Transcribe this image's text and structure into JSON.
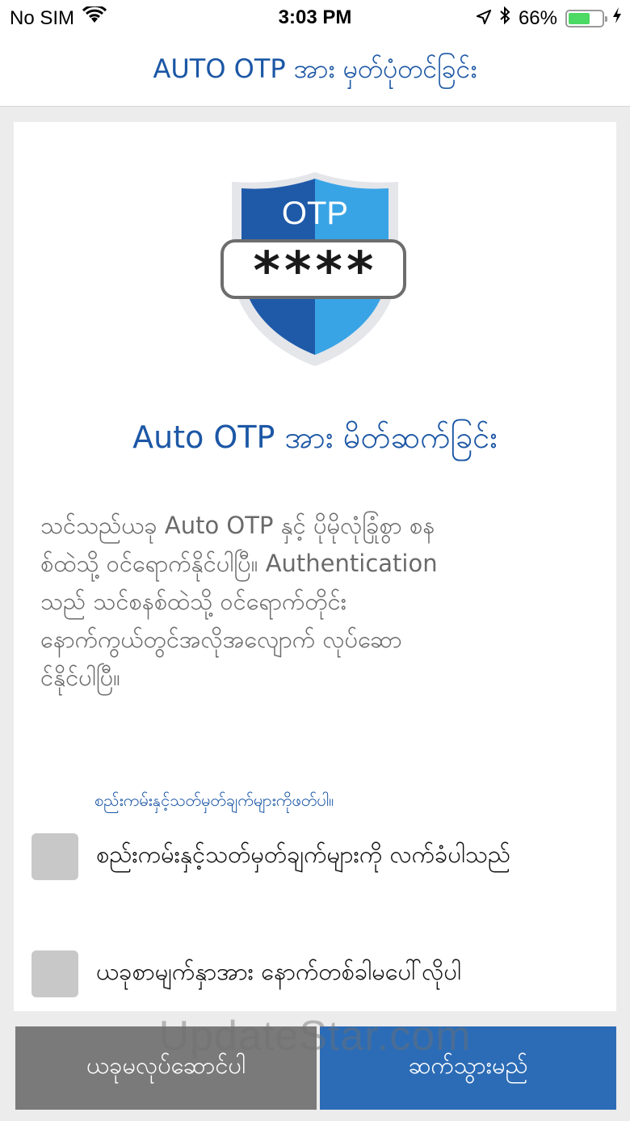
{
  "status_bar": {
    "carrier": "No SIM",
    "time": "3:03 PM",
    "battery": "66%",
    "battery_level": 0.66,
    "icons": [
      "wifi-icon",
      "location-arrow-icon",
      "bluetooth-icon",
      "battery-icon",
      "charging-bolt-icon"
    ]
  },
  "nav": {
    "title": "AUTO OTP အား မှတ်ပုံတင်ခြင်း"
  },
  "illustration": {
    "icon": "otp-shield-icon",
    "label": "OTP",
    "code_mask": "****",
    "colors": {
      "dark_blue": "#1f5aa9",
      "light_blue": "#38a4e6",
      "rim": "#e4e6ea"
    }
  },
  "card": {
    "title": "Auto OTP အား မိတ်ဆက်ခြင်း",
    "description": [
      "သင်သည်ယခု Auto OTP နှင့် ပိုမိုလုံခြုံစွာ စန",
      "စ်ထဲသို့ ဝင်ရောက်နိုင်ပါပြီ။ Authentication",
      "သည် သင်စနစ်ထဲသို့ ဝင်ရောက်တိုင်း",
      "နောက်ကွယ်တွင်အလိုအလျောက် လုပ်ဆော",
      "င်နိုင်ပါပြီ။"
    ],
    "terms_link": "စည်းကမ်းနှင့်သတ်မှတ်ချက်များကိုဖတ်ပါ။",
    "checkboxes": [
      {
        "label": "စည်းကမ်းနှင့်သတ်မှတ်ချက်များကို လက်ခံပါသည်"
      },
      {
        "label": "ယခုစာမျက်နှာအား နောက်တစ်ခါမပေါ်လိုပါ"
      }
    ]
  },
  "buttons": {
    "decline": "ယခုမလုပ်ဆောင်ပါ",
    "continue": "ဆက်သွားမည်"
  },
  "watermark": "UpdateStar.com",
  "colors": {
    "accent": "#1c57a5",
    "primary_button": "#2c6cb6",
    "secondary_button": "#7a7a7a",
    "checkbox": "#c8c8c8"
  }
}
